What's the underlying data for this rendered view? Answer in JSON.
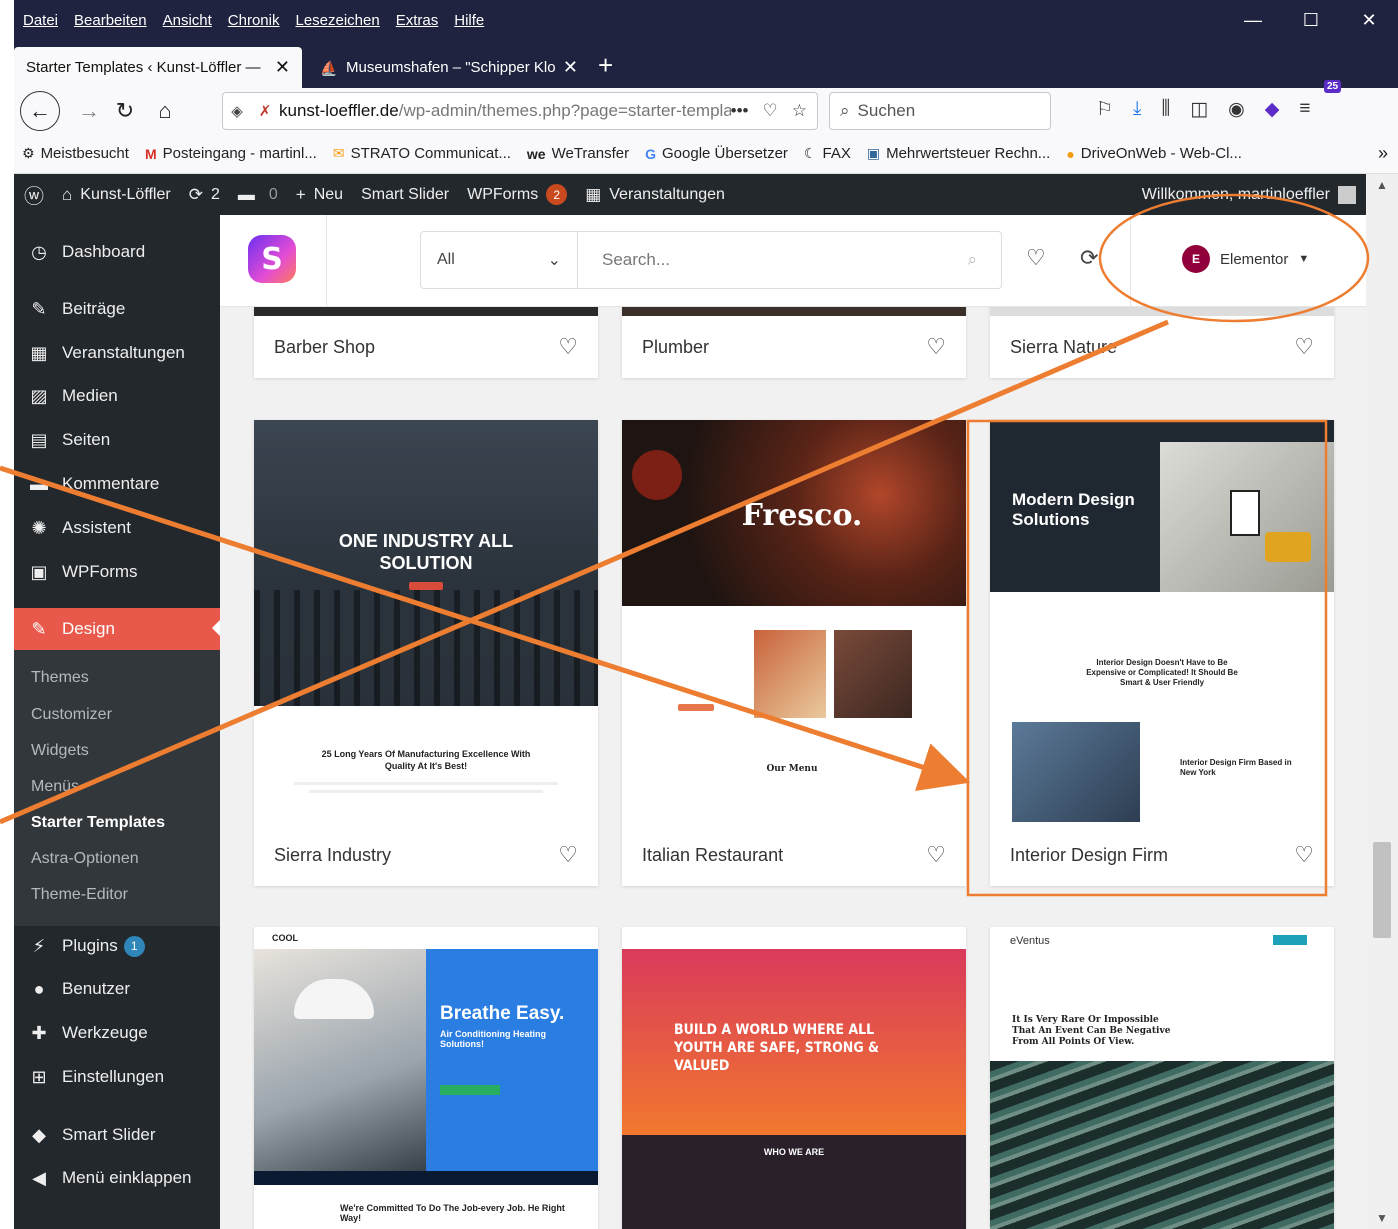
{
  "menubar": {
    "items": [
      "Datei",
      "Bearbeiten",
      "Ansicht",
      "Chronik",
      "Lesezeichen",
      "Extras",
      "Hilfe"
    ]
  },
  "tabs": [
    {
      "title": "Starter Templates ‹ Kunst-Löffler —",
      "close": "✕"
    },
    {
      "title": "Museumshafen – \"Schipper Klo",
      "close": "✕"
    }
  ],
  "newtab": "+",
  "url": {
    "host": "kunst-loeffler.de",
    "path": "/wp-admin/themes.php?page=starter-templates",
    "more": "•••"
  },
  "search": {
    "placeholder": "Suchen"
  },
  "ext_badge": "25",
  "bookmarks": [
    {
      "icon": "⚙",
      "label": "Meistbesucht"
    },
    {
      "icon": "M",
      "label": "Posteingang - martinl..."
    },
    {
      "icon": "✉",
      "label": "STRATO Communicat..."
    },
    {
      "icon": "we",
      "label": "WeTransfer"
    },
    {
      "icon": "G",
      "label": "Google Übersetzer"
    },
    {
      "icon": "☾",
      "label": "FAX"
    },
    {
      "icon": "▣",
      "label": "Mehrwertsteuer Rechn..."
    },
    {
      "icon": "●",
      "label": "DriveOnWeb - Web-Cl..."
    }
  ],
  "bookmarks_more": "»",
  "adminbar": {
    "site": "Kunst-Löffler",
    "updates": "2",
    "comments": "0",
    "new": "Neu",
    "smart_slider": "Smart Slider",
    "wpforms": "WPForms",
    "wpforms_badge": "2",
    "events": "Veranstaltungen",
    "welcome": "Willkommen, martinloeffler"
  },
  "sidebar": {
    "top": [
      {
        "icon": "◷",
        "label": "Dashboard",
        "name": "dashboard"
      },
      {
        "icon": "✎",
        "label": "Beiträge",
        "name": "beitraege"
      },
      {
        "icon": "▦",
        "label": "Veranstaltungen",
        "name": "veranstaltungen"
      },
      {
        "icon": "▨",
        "label": "Medien",
        "name": "medien"
      },
      {
        "icon": "▤",
        "label": "Seiten",
        "name": "seiten"
      },
      {
        "icon": "▬",
        "label": "Kommentare",
        "name": "kommentare"
      },
      {
        "icon": "✺",
        "label": "Assistent",
        "name": "assistent"
      },
      {
        "icon": "▣",
        "label": "WPForms",
        "name": "wpforms"
      }
    ],
    "design": {
      "icon": "✎",
      "label": "Design"
    },
    "submenu": [
      "Themes",
      "Customizer",
      "Widgets",
      "Menüs",
      "Starter Templates",
      "Astra-Optionen",
      "Theme-Editor"
    ],
    "bottom": [
      {
        "icon": "⚡",
        "label": "Plugins",
        "name": "plugins",
        "badge": "1"
      },
      {
        "icon": "●",
        "label": "Benutzer",
        "name": "benutzer"
      },
      {
        "icon": "✚",
        "label": "Werkzeuge",
        "name": "werkzeuge"
      },
      {
        "icon": "⊞",
        "label": "Einstellungen",
        "name": "einstellungen"
      },
      {
        "icon": "◆",
        "label": "Smart Slider",
        "name": "smart-slider"
      },
      {
        "icon": "◀",
        "label": "Menü einklappen",
        "name": "menue-einklappen"
      }
    ]
  },
  "starter": {
    "filter_value": "All",
    "search_placeholder": "Search...",
    "builder": "Elementor"
  },
  "cards": [
    {
      "title": "Barber Shop"
    },
    {
      "title": "Plumber"
    },
    {
      "title": "Sierra Nature"
    },
    {
      "title": "Sierra Industry",
      "hero": "ONE INDUSTRY ALL SOLUTION",
      "sub": "25 Long Years Of Manufacturing Excellence With Quality At It's Best!"
    },
    {
      "title": "Italian Restaurant",
      "hero": "Fresco.",
      "sub": "Our Menu"
    },
    {
      "title": "Interior Design Firm",
      "hero": "Modern Design Solutions",
      "sub": "Interior Design Doesn't Have to Be Expensive or Complicated! It Should Be Smart & User Friendly",
      "sub2": "Interior Design Firm Based in New York"
    },
    {
      "hero": "Breathe Easy.",
      "sub": "Air Conditioning Heating Solutions!",
      "foot": "We're Committed To Do The Job-every Job. He Right Way!",
      "logo": "COOL"
    },
    {
      "hero": "BUILD A WORLD WHERE ALL YOUTH ARE SAFE, STRONG & VALUED",
      "sub": "WHO WE ARE"
    },
    {
      "hero": "It Is Very Rare Or Impossible That An Event Can Be Negative From All Points Of View.",
      "logo": "eVentus"
    }
  ],
  "colors": {
    "accent": "#e8584b",
    "annotation": "#ed7d31",
    "adminbar": "#23282d"
  }
}
